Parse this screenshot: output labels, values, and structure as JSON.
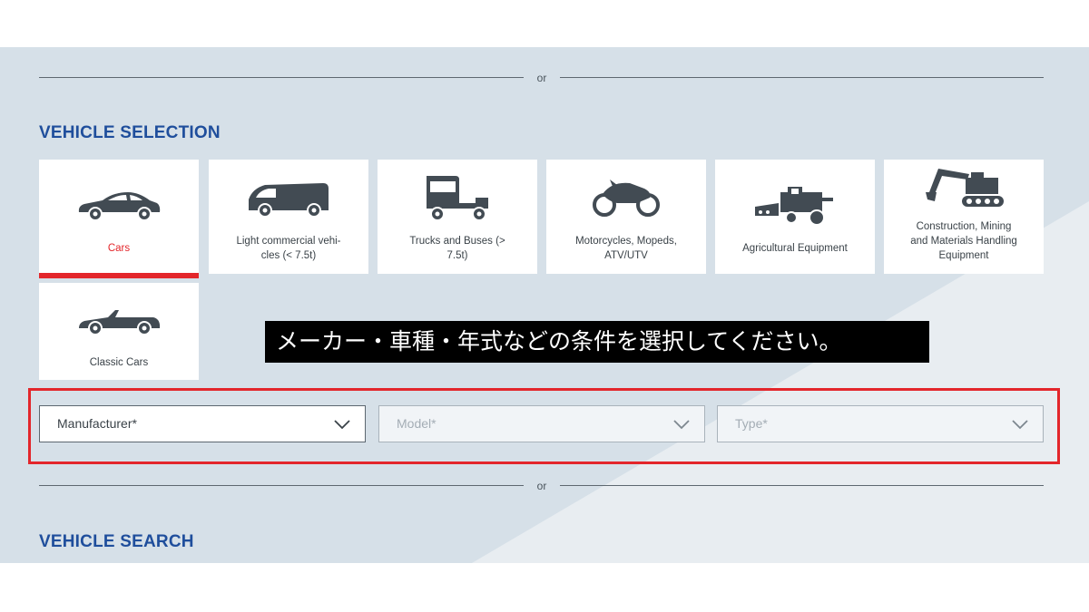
{
  "divider_text": "or",
  "selection": {
    "heading": "VEHICLE SELECTION",
    "categories": [
      {
        "label": "Cars",
        "icon": "car-icon",
        "active": true
      },
      {
        "label": "Light commercial vehi-\ncles (< 7.5t)",
        "icon": "van-icon",
        "active": false
      },
      {
        "label": "Trucks and Buses (>\n7.5t)",
        "icon": "truck-icon",
        "active": false
      },
      {
        "label": "Motorcycles, Mopeds,\nATV/UTV",
        "icon": "motorcycle-icon",
        "active": false
      },
      {
        "label": "Agricultural Equipment",
        "icon": "harvester-icon",
        "active": false
      },
      {
        "label": "Construction, Mining\nand Materials Handling\nEquipment",
        "icon": "excavator-icon",
        "active": false
      },
      {
        "label": "Classic Cars",
        "icon": "convertible-icon",
        "active": false
      }
    ]
  },
  "caption": "メーカー・車種・年式などの条件を選択してください。",
  "filters": {
    "manufacturer": "Manufacturer*",
    "model": "Model*",
    "type": "Type*"
  },
  "search": {
    "heading": "VEHICLE SEARCH"
  },
  "colors": {
    "accent_red": "#e3262b",
    "heading_blue": "#1f4e9c",
    "panel_bg": "#d6e0e8",
    "icon_gray": "#424b53"
  }
}
